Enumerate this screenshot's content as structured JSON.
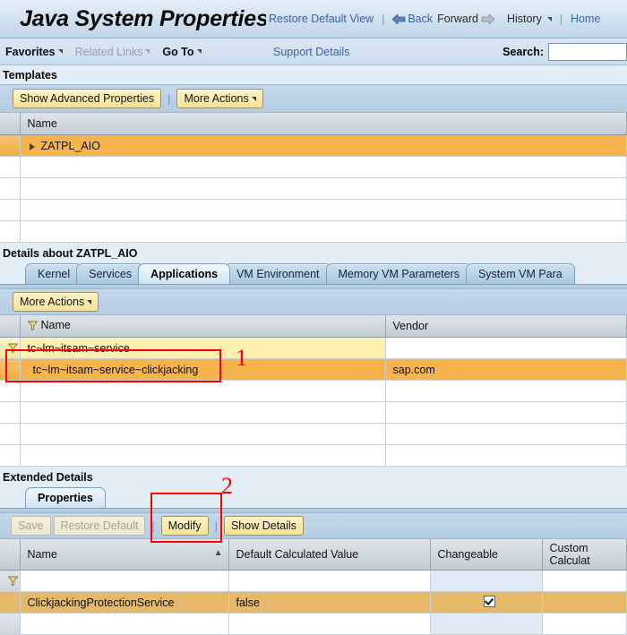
{
  "header": {
    "title": "Java System Properties",
    "restore_default_view": "Restore Default View",
    "back": "Back",
    "forward": "Forward",
    "history": "History",
    "home": "Home",
    "separator": "|"
  },
  "menubar": {
    "favorites": "Favorites",
    "related_links": "Related Links",
    "go_to": "Go To",
    "support_details": "Support Details",
    "search_label": "Search:",
    "search_value": "",
    "search_placeholder": ""
  },
  "templates": {
    "section_title": "Templates",
    "toolbar": {
      "show_advanced_properties": "Show Advanced Properties",
      "more_actions": "More Actions",
      "separator": "|"
    },
    "columns": [
      "Name"
    ],
    "rows": [
      {
        "name": "ZATPL_AIO",
        "selected": true,
        "expandable": true
      },
      {
        "name": "",
        "selected": false,
        "expandable": false
      },
      {
        "name": "",
        "selected": false,
        "expandable": false
      },
      {
        "name": "",
        "selected": false,
        "expandable": false
      },
      {
        "name": "",
        "selected": false,
        "expandable": false
      }
    ]
  },
  "details": {
    "section_title": "Details about ZATPL_AIO",
    "tabs": [
      {
        "label": "Kernel",
        "selected": false
      },
      {
        "label": "Services",
        "selected": false
      },
      {
        "label": "Applications",
        "selected": true
      },
      {
        "label": "VM Environment",
        "selected": false
      },
      {
        "label": "Memory VM Parameters",
        "selected": false
      },
      {
        "label": "System VM Para",
        "selected": false
      }
    ],
    "toolbar": {
      "more_actions": "More Actions"
    },
    "columns": [
      "Name",
      "Vendor"
    ],
    "filter_row": {
      "name": "tc~lm~itsam~service",
      "vendor": ""
    },
    "rows": [
      {
        "name": "tc~lm~itsam~service~clickjacking",
        "vendor": "sap.com",
        "selected": true
      },
      {
        "name": "",
        "vendor": "",
        "selected": false
      },
      {
        "name": "",
        "vendor": "",
        "selected": false
      },
      {
        "name": "",
        "vendor": "",
        "selected": false
      },
      {
        "name": "",
        "vendor": "",
        "selected": false
      }
    ]
  },
  "extended": {
    "section_title": "Extended Details",
    "tabs": [
      {
        "label": "Properties",
        "selected": true
      }
    ],
    "toolbar": {
      "save": "Save",
      "restore_default": "Restore Default",
      "modify": "Modify",
      "show_details": "Show Details",
      "separator": "|"
    },
    "columns": [
      "Name",
      "Default Calculated Value",
      "Changeable",
      "Custom Calculat"
    ],
    "filter_row": {
      "name": "",
      "default_value": "",
      "changeable": "",
      "custom": ""
    },
    "rows": [
      {
        "name": "ClickjackingProtectionService",
        "default_value": "false",
        "changeable_checked": true,
        "custom": "",
        "selected": true
      }
    ]
  },
  "annotations": [
    {
      "id": "1",
      "label": "1"
    },
    {
      "id": "2",
      "label": "2"
    }
  ],
  "colors": {
    "selection_orange": "#f7b34c",
    "filter_yellow": "#fdf0b0",
    "annotation_red": "#ff0000",
    "link_blue": "#3a63a8",
    "button_yellow": "#f6e39a"
  }
}
